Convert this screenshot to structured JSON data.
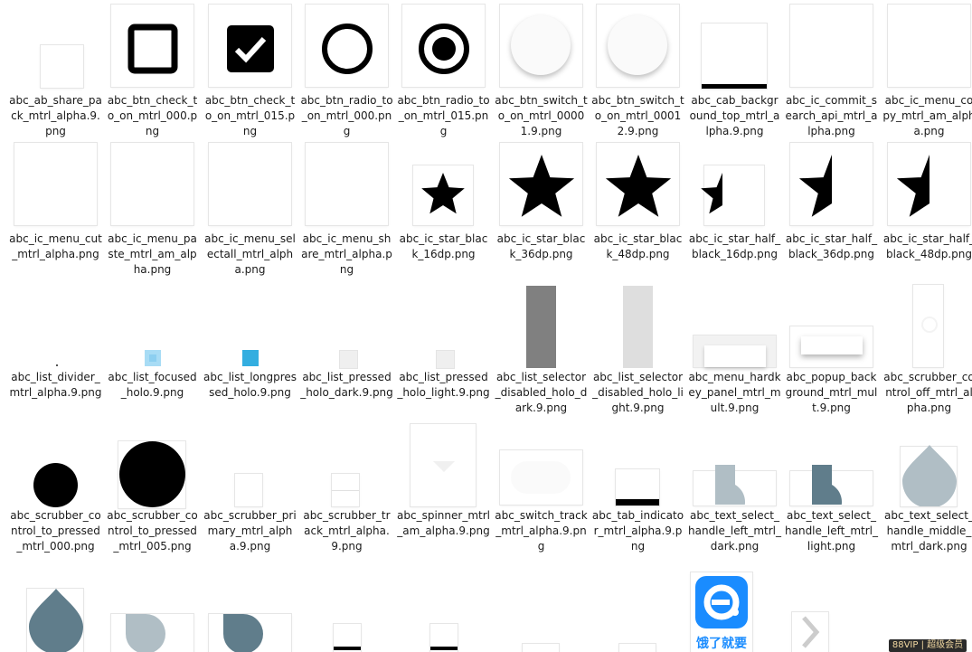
{
  "files": [
    {
      "name": "abc_ab_share_pack_mtrl_alpha.9.png",
      "type": "share_pack"
    },
    {
      "name": "abc_btn_check_to_on_mtrl_000.png",
      "type": "check_off"
    },
    {
      "name": "abc_btn_check_to_on_mtrl_015.png",
      "type": "check_on"
    },
    {
      "name": "abc_btn_radio_to_on_mtrl_000.png",
      "type": "radio_off"
    },
    {
      "name": "abc_btn_radio_to_on_mtrl_015.png",
      "type": "radio_on"
    },
    {
      "name": "abc_btn_switch_to_on_mtrl_00001.9.png",
      "type": "switch_thumb"
    },
    {
      "name": "abc_btn_switch_to_on_mtrl_00012.9.png",
      "type": "switch_thumb2"
    },
    {
      "name": "abc_cab_background_top_mtrl_alpha.9.png",
      "type": "cab_top"
    },
    {
      "name": "abc_ic_commit_search_api_mtrl_alpha.png",
      "type": "faint_box"
    },
    {
      "name": "abc_ic_menu_copy_mtrl_am_alpha.png",
      "type": "faint_box"
    },
    {
      "name": "abc_ic_menu_cut_mtrl_alpha.png",
      "type": "faint_box"
    },
    {
      "name": "abc_ic_menu_paste_mtrl_am_alpha.png",
      "type": "faint_box"
    },
    {
      "name": "abc_ic_menu_selectall_mtrl_alpha.png",
      "type": "faint_box"
    },
    {
      "name": "abc_ic_menu_share_mtrl_alpha.png",
      "type": "faint_box"
    },
    {
      "name": "abc_ic_star_black_16dp.png",
      "type": "star16"
    },
    {
      "name": "abc_ic_star_black_36dp.png",
      "type": "star36"
    },
    {
      "name": "abc_ic_star_black_48dp.png",
      "type": "star48"
    },
    {
      "name": "abc_ic_star_half_black_16dp.png",
      "type": "half16"
    },
    {
      "name": "abc_ic_star_half_black_36dp.png",
      "type": "half36"
    },
    {
      "name": "abc_ic_star_half_black_48dp.png",
      "type": "half48"
    },
    {
      "name": "abc_list_divider_mtrl_alpha.9.png",
      "type": "tiny_dot"
    },
    {
      "name": "abc_list_focused_holo.9.png",
      "type": "focused"
    },
    {
      "name": "abc_list_longpressed_holo.9.png",
      "type": "longpressed"
    },
    {
      "name": "abc_list_pressed_holo_dark.9.png",
      "type": "pressed_sq"
    },
    {
      "name": "abc_list_pressed_holo_light.9.png",
      "type": "pressed_sq"
    },
    {
      "name": "abc_list_selector_disabled_holo_dark.9.png",
      "type": "sel_dark"
    },
    {
      "name": "abc_list_selector_disabled_holo_light.9.png",
      "type": "sel_light"
    },
    {
      "name": "abc_menu_hardkey_panel_mtrl_mult.9.png",
      "type": "panel"
    },
    {
      "name": "abc_popup_background_mtrl_mult.9.png",
      "type": "popup"
    },
    {
      "name": "abc_scrubber_control_off_mtrl_alpha.png",
      "type": "scrub_off"
    },
    {
      "name": "abc_scrubber_control_to_pressed_mtrl_000.png",
      "type": "dot_small"
    },
    {
      "name": "abc_scrubber_control_to_pressed_mtrl_005.png",
      "type": "dot_big"
    },
    {
      "name": "abc_scrubber_primary_mtrl_alpha.9.png",
      "type": "small_box"
    },
    {
      "name": "abc_scrubber_track_mtrl_alpha.9.png",
      "type": "small_box_line"
    },
    {
      "name": "abc_spinner_mtrl_am_alpha.9.png",
      "type": "spinner"
    },
    {
      "name": "abc_switch_track_mtrl_alpha.9.png",
      "type": "switch_track"
    },
    {
      "name": "abc_tab_indicator_mtrl_alpha.9.png",
      "type": "tab_ind"
    },
    {
      "name": "abc_text_select_handle_left_mtrl_dark.png",
      "type": "handle_left_gray"
    },
    {
      "name": "abc_text_select_handle_left_mtrl_light.png",
      "type": "handle_left_dark"
    },
    {
      "name": "abc_text_select_handle_middle_mtrl_dark.png",
      "type": "handle_mid"
    }
  ],
  "bottom_row": [
    {
      "type": "drop_dark"
    },
    {
      "type": "handle_right_gray"
    },
    {
      "type": "handle_right_dark"
    },
    {
      "type": "bar_box"
    },
    {
      "type": "bar_box"
    },
    {
      "type": "partial_box"
    },
    {
      "type": "partial_box"
    },
    {
      "type": "eleme_logo"
    },
    {
      "type": "chevron"
    }
  ],
  "eleme_logo": {
    "text": "饿了就要",
    "brand_color": "#1a8cff"
  },
  "vip_badge": {
    "text": "88VIP | 超级会员"
  },
  "colors": {
    "handle_gray": "#b0bec5",
    "handle_dark": "#607d8b",
    "focused": "#8ccff0",
    "longpressed": "#33aee0"
  }
}
